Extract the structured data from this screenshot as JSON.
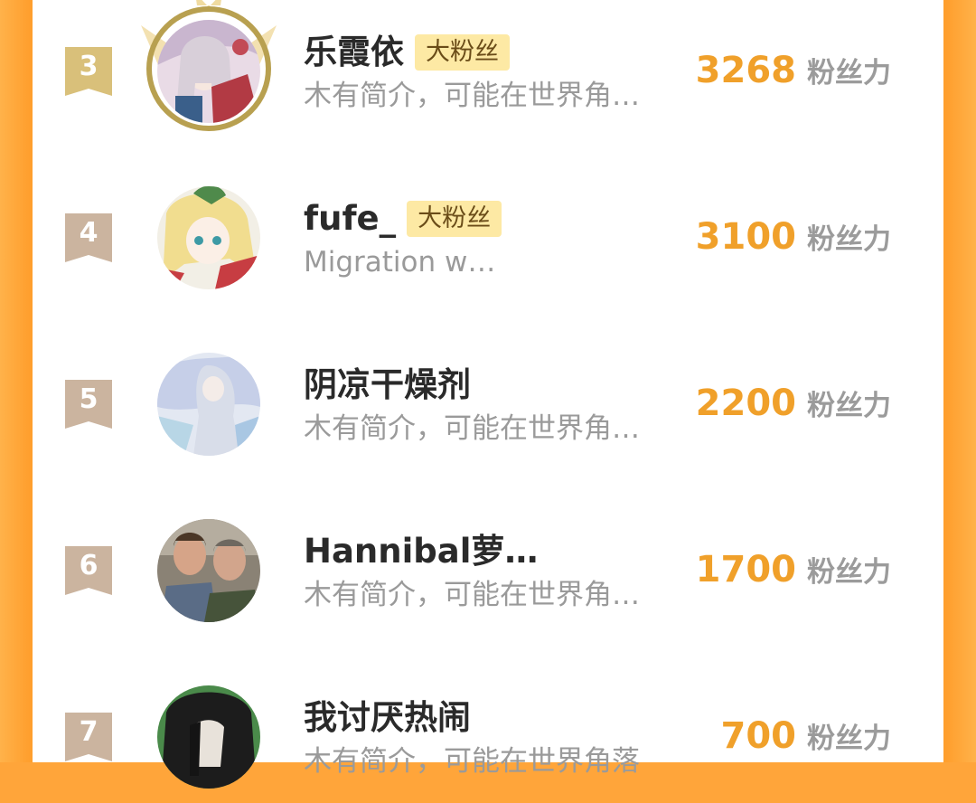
{
  "colors": {
    "frame": "#ff9f2e",
    "panel": "#ffffff",
    "score": "#f0a02a",
    "badge_bg": "#fde9a4",
    "rank_gold": "#d9c07a",
    "rank_bronze": "#cbb49f"
  },
  "leaderboard": {
    "unit_label": "粉丝力",
    "entries": [
      {
        "rank": "3",
        "name": "乐霞依",
        "badge": "大粉丝",
        "bio": "木有简介，可能在世界角…",
        "score": "3268",
        "avatar_icon": "anime-girl-avatar",
        "crowned": true
      },
      {
        "rank": "4",
        "name": "fufe_",
        "badge": "大粉丝",
        "bio": "Migration w…",
        "score": "3100",
        "avatar_icon": "anime-girl-avatar",
        "crowned": false
      },
      {
        "rank": "5",
        "name": "阴凉干燥剂",
        "badge": "",
        "bio": "木有简介，可能在世界角…",
        "score": "2200",
        "avatar_icon": "anime-girl-avatar",
        "crowned": false
      },
      {
        "rank": "6",
        "name": "Hannibal萝…",
        "badge": "",
        "bio": "木有简介，可能在世界角…",
        "score": "1700",
        "avatar_icon": "photo-avatar",
        "crowned": false
      },
      {
        "rank": "7",
        "name": "我讨厌热闹",
        "badge": "",
        "bio": "木有简介，可能在世界角落",
        "score": "700",
        "avatar_icon": "dark-hair-avatar",
        "crowned": false
      }
    ]
  }
}
